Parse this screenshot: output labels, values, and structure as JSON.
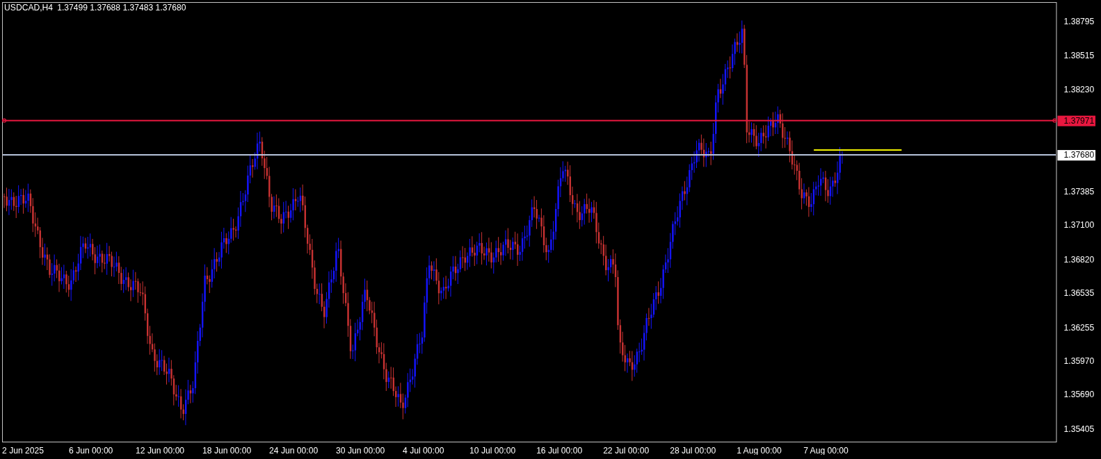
{
  "header": {
    "symbol": "USDCAD,H4",
    "quotes": "1.37499 1.37688 1.37483 1.37680"
  },
  "price_axis": [
    "1.38795",
    "1.38515",
    "1.38230",
    "1.37385",
    "1.37100",
    "1.36820",
    "1.36535",
    "1.36255",
    "1.35970",
    "1.35690",
    "1.35405"
  ],
  "time_axis": [
    "2 Jun 2025",
    "6 Jun 00:00",
    "12 Jun 00:00",
    "18 Jun 00:00",
    "24 Jun 00:00",
    "30 Jun 00:00",
    "4 Jul 00:00",
    "10 Jul 00:00",
    "16 Jul 00:00",
    "22 Jul 00:00",
    "28 Jul 00:00",
    "1 Aug 00:00",
    "7 Aug 00:00"
  ],
  "lines": [
    {
      "kind": "horizontal",
      "color": "#e8173f",
      "tag": "1.37971",
      "selected": true
    },
    {
      "kind": "bid",
      "color": "#b8c4dc",
      "tag": "1.37680"
    },
    {
      "kind": "trend",
      "color": "#f5f500"
    }
  ]
}
